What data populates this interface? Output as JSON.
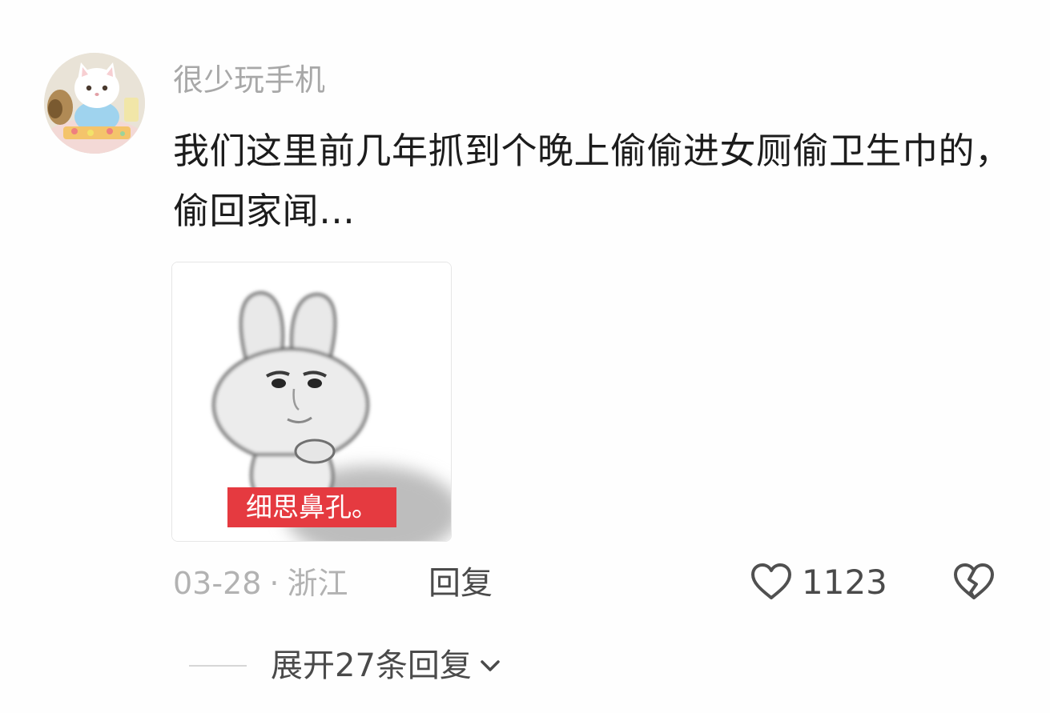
{
  "comment": {
    "username": "很少玩手机",
    "text": "我们这里前几年抓到个晚上偷偷进女厕偷卫生巾的，偷回家闻…",
    "sticker": {
      "caption": "细思鼻孔。"
    },
    "meta": {
      "date": "03-28",
      "separator": "·",
      "location": "浙江",
      "reply_label": "回复"
    },
    "like_count": "1123",
    "expand_label": "展开27条回复"
  },
  "icons": {
    "like": "heart-outline-icon",
    "dislike": "broken-heart-icon",
    "expand": "chevron-down-icon"
  },
  "colors": {
    "text_primary": "#1c1c1c",
    "text_secondary": "#a8a8a8",
    "action_text": "#4a4a4a",
    "caption_bg": "#e53a40"
  }
}
